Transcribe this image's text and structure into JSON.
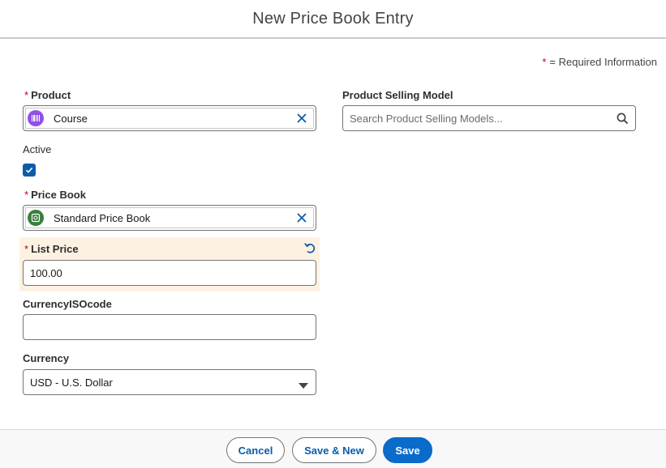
{
  "modal": {
    "title": "New Price Book Entry"
  },
  "required_info": {
    "star": "*",
    "text": "= Required Information"
  },
  "fields": {
    "product": {
      "label": "Product",
      "required": "*",
      "value": "Course",
      "icon": "product-icon",
      "icon_color": "#9050e9"
    },
    "active": {
      "label": "Active",
      "checked": true
    },
    "price_book": {
      "label": "Price Book",
      "required": "*",
      "value": "Standard Price Book",
      "icon": "pricebook-icon",
      "icon_color": "#3a7e3b"
    },
    "list_price": {
      "label": "List Price",
      "required": "*",
      "value": "100.00"
    },
    "currency_iso": {
      "label": "CurrencyISOcode",
      "value": ""
    },
    "currency": {
      "label": "Currency",
      "value": "USD - U.S. Dollar"
    },
    "product_selling_model": {
      "label": "Product Selling Model",
      "placeholder": "Search Product Selling Models..."
    }
  },
  "footer": {
    "cancel_label": "Cancel",
    "save_new_label": "Save & New",
    "save_label": "Save"
  },
  "colors": {
    "brand": "#0b6bcb",
    "required": "#ba0517",
    "edited_bg": "#fdf2e2"
  }
}
